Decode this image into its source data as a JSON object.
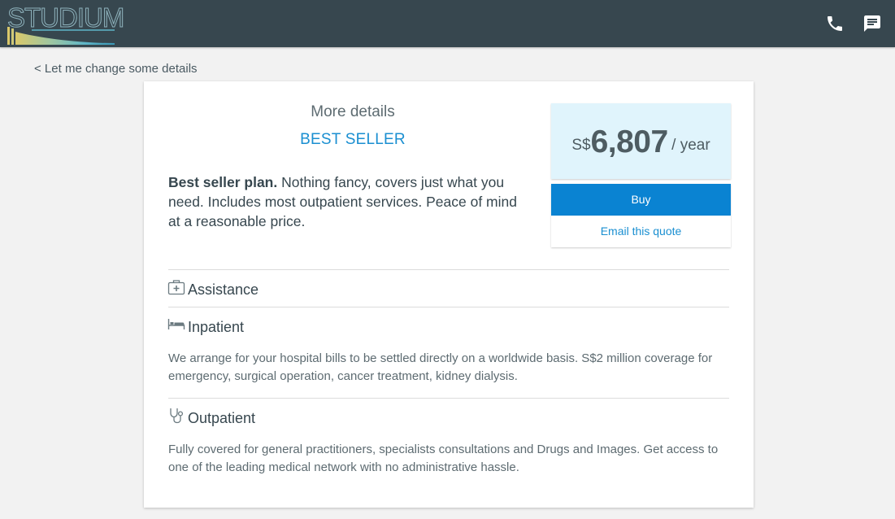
{
  "header": {
    "logo_text": "STUDIUM",
    "phone_icon": "phone-icon",
    "chat_icon": "chat-icon",
    "background_color": "#37474f"
  },
  "back_link": "< Let me change some details",
  "plan": {
    "heading": "More details",
    "badge": "BEST SELLER",
    "description_bold": "Best seller plan.",
    "description_rest": " Nothing fancy, covers just what you need. Includes most outpatient services. Peace of mind at a reasonable price."
  },
  "price": {
    "currency": "S$",
    "amount": "6,807",
    "period": "/ year"
  },
  "actions": {
    "buy_label": "Buy",
    "email_label": "Email this quote",
    "accent_color": "#0a83d2"
  },
  "sections": [
    {
      "icon": "medical-kit-icon",
      "title": "Assistance",
      "text": ""
    },
    {
      "icon": "bed-icon",
      "title": "Inpatient",
      "text": "We arrange for your hospital bills to be settled directly on a worldwide basis. S$2 million coverage for emergency, surgical operation, cancer treatment, kidney dialysis."
    },
    {
      "icon": "stethoscope-icon",
      "title": "Outpatient",
      "text": "Fully covered for general practitioners, specialists consultations and Drugs and Images. Get access to one of the leading medical network with no administrative hassle."
    }
  ]
}
